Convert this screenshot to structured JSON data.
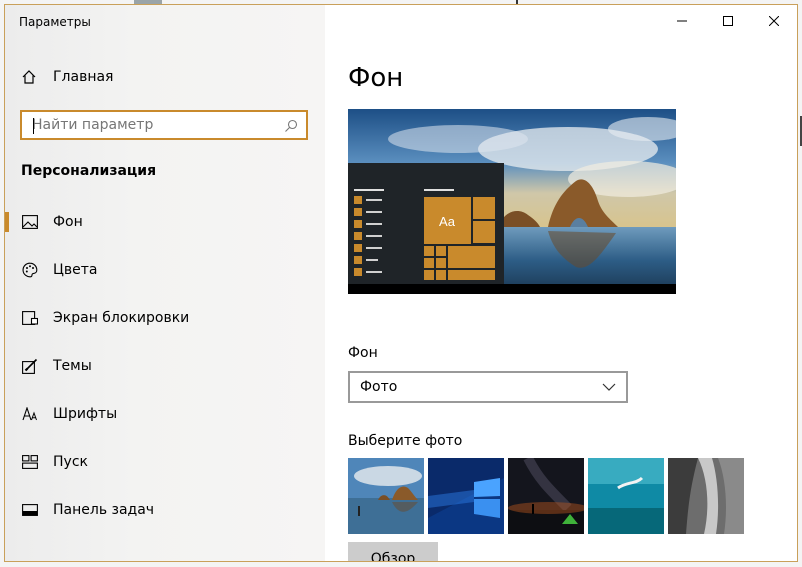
{
  "window": {
    "title": "Параметры"
  },
  "sidebar": {
    "home_label": "Главная",
    "search_placeholder": "Найти параметр",
    "section_title": "Персонализация",
    "items": [
      {
        "label": "Фон",
        "icon": "picture-icon",
        "active": true
      },
      {
        "label": "Цвета",
        "icon": "palette-icon",
        "active": false
      },
      {
        "label": "Экран блокировки",
        "icon": "lock-screen-icon",
        "active": false
      },
      {
        "label": "Темы",
        "icon": "themes-icon",
        "active": false
      },
      {
        "label": "Шрифты",
        "icon": "fonts-icon",
        "active": false
      },
      {
        "label": "Пуск",
        "icon": "start-icon",
        "active": false
      },
      {
        "label": "Панель задач",
        "icon": "taskbar-icon",
        "active": false
      }
    ]
  },
  "main": {
    "title": "Фон",
    "preview_tile_text": "Aa",
    "background_label": "Фон",
    "background_value": "Фото",
    "choose_photo_label": "Выберите фото",
    "browse_label": "Обзор"
  },
  "colors": {
    "accent": "#c98a2c"
  }
}
